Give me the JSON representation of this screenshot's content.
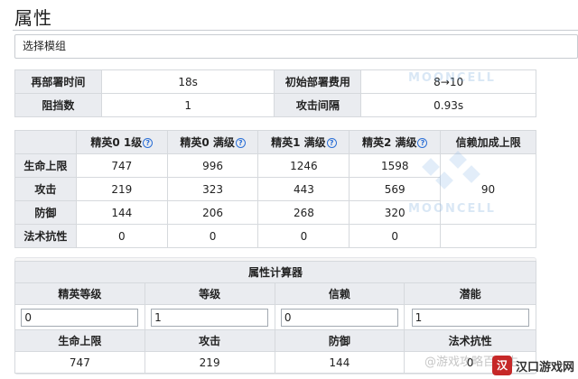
{
  "header": {
    "title": "属性"
  },
  "select": {
    "value": "选择模组"
  },
  "basic_stats": {
    "rows": [
      {
        "label_a": "再部署时间",
        "value_a": "18s",
        "label_b": "初始部署费用",
        "value_b": "8→10"
      },
      {
        "label_a": "阻挡数",
        "value_a": "1",
        "label_b": "攻击间隔",
        "value_b": "0.93s"
      }
    ]
  },
  "stats_table": {
    "headers": [
      "精英0 1级",
      "精英0 满级",
      "精英1 满级",
      "精英2 满级",
      "信赖加成上限"
    ],
    "help_icon": "?",
    "rows": [
      {
        "label": "生命上限",
        "values": [
          "747",
          "996",
          "1246",
          "1598"
        ]
      },
      {
        "label": "攻击",
        "values": [
          "219",
          "323",
          "443",
          "569"
        ]
      },
      {
        "label": "防御",
        "values": [
          "144",
          "206",
          "268",
          "320"
        ]
      },
      {
        "label": "法术抗性",
        "values": [
          "0",
          "0",
          "0",
          "0"
        ]
      }
    ],
    "trust_bonus": "90"
  },
  "calculator": {
    "title": "属性计算器",
    "input_labels": [
      "精英等级",
      "等级",
      "信赖",
      "潜能"
    ],
    "input_values": [
      "0",
      "1",
      "0",
      "1"
    ],
    "result_labels": [
      "生命上限",
      "攻击",
      "防御",
      "法术抗性"
    ],
    "result_values": [
      "747",
      "219",
      "144",
      "0"
    ]
  },
  "watermarks": {
    "mooncell": "MOONCELL",
    "bottom_text": "@游戏攻略百晓生"
  },
  "corner_logo": {
    "mark": "汉",
    "text": "汉口游戏网"
  }
}
